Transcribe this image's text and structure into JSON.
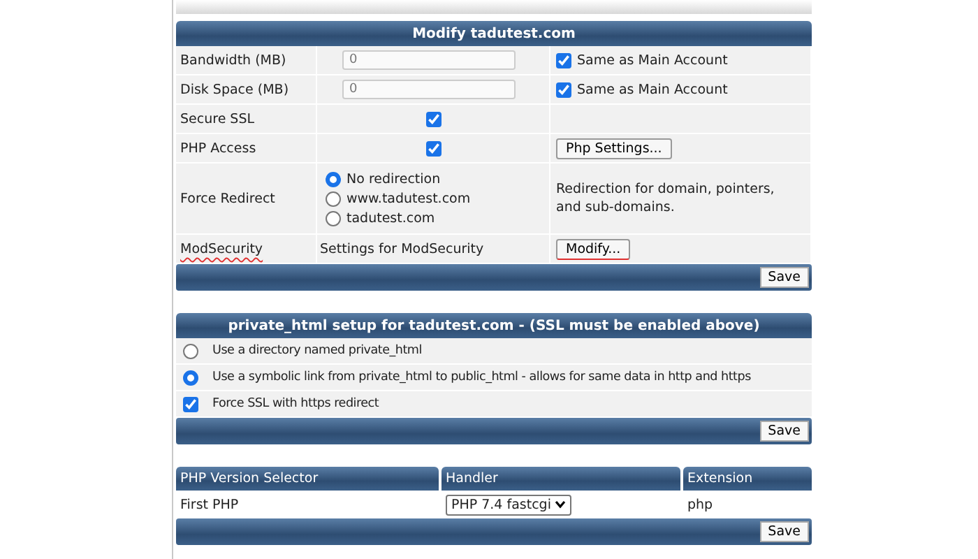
{
  "modify": {
    "title": "Modify tadutest.com",
    "rows": [
      {
        "kind": "input",
        "label": "Bandwidth (MB)",
        "value": "0",
        "option": {
          "label": "Same as Main Account",
          "checked": true
        }
      },
      {
        "kind": "input",
        "label": "Disk Space (MB)",
        "value": "0",
        "option": {
          "label": "Same as Main Account",
          "checked": true
        }
      },
      {
        "kind": "checkbox",
        "label": "Secure SSL",
        "checked": true
      },
      {
        "kind": "checkbox",
        "label": "PHP Access",
        "checked": true,
        "button": "Php Settings..."
      },
      {
        "kind": "radio",
        "label": "Force Redirect",
        "options": [
          {
            "label": "No redirection",
            "selected": true
          },
          {
            "label": "www.tadutest.com",
            "selected": false
          },
          {
            "label": "tadutest.com",
            "selected": false
          }
        ],
        "note": "Redirection for domain, pointers, and sub-domains."
      },
      {
        "kind": "setting",
        "label": "ModSecurity",
        "text": "Settings for ModSecurity",
        "button": "Modify..."
      }
    ],
    "save": "Save"
  },
  "private_html": {
    "title": "private_html setup for tadutest.com - (SSL must be enabled above)",
    "options": [
      {
        "kind": "radio",
        "label": "Use a directory named private_html",
        "selected": false
      },
      {
        "kind": "radio",
        "label": "Use a symbolic link from private_html to public_html - allows for same data in http and https",
        "selected": true
      },
      {
        "kind": "checkbox",
        "label": "Force SSL with https redirect",
        "checked": true
      }
    ],
    "save": "Save"
  },
  "php_table": {
    "columns": [
      "PHP Version Selector",
      "Handler",
      "Extension"
    ],
    "rows": [
      {
        "name": "First PHP",
        "handler": "PHP 7.4 fastcgi",
        "extension": "php"
      }
    ],
    "save": "Save"
  }
}
